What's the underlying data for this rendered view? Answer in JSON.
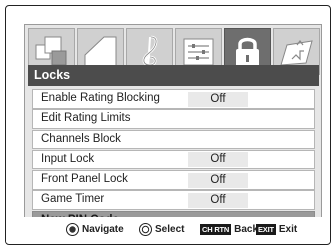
{
  "menu": {
    "tabs": [
      {
        "icon": "picture-icon"
      },
      {
        "icon": "audio-icon"
      },
      {
        "icon": "music-clef-icon"
      },
      {
        "icon": "preferences-icon"
      },
      {
        "icon": "lock-icon",
        "active": true
      },
      {
        "icon": "setup-icon"
      }
    ],
    "header": "Locks",
    "items": [
      {
        "label": "Enable Rating Blocking",
        "value": "Off"
      },
      {
        "label": "Edit Rating Limits",
        "value": ""
      },
      {
        "label": "Channels Block",
        "value": ""
      },
      {
        "label": "Input Lock",
        "value": "Off"
      },
      {
        "label": "Front Panel Lock",
        "value": "Off"
      },
      {
        "label": "Game Timer",
        "value": "Off"
      },
      {
        "label": "New PIN Code",
        "value": "",
        "selected": true
      }
    ]
  },
  "footer": {
    "navigate": "Navigate",
    "select": "Select",
    "back_key": "CH RTN",
    "back": "Back",
    "exit_key": "EXIT",
    "exit": "Exit"
  },
  "colors": {
    "header_bg": "#4c4c4c",
    "selected_row": "#9a9a9a",
    "active_tab": "#6e6e6e"
  }
}
